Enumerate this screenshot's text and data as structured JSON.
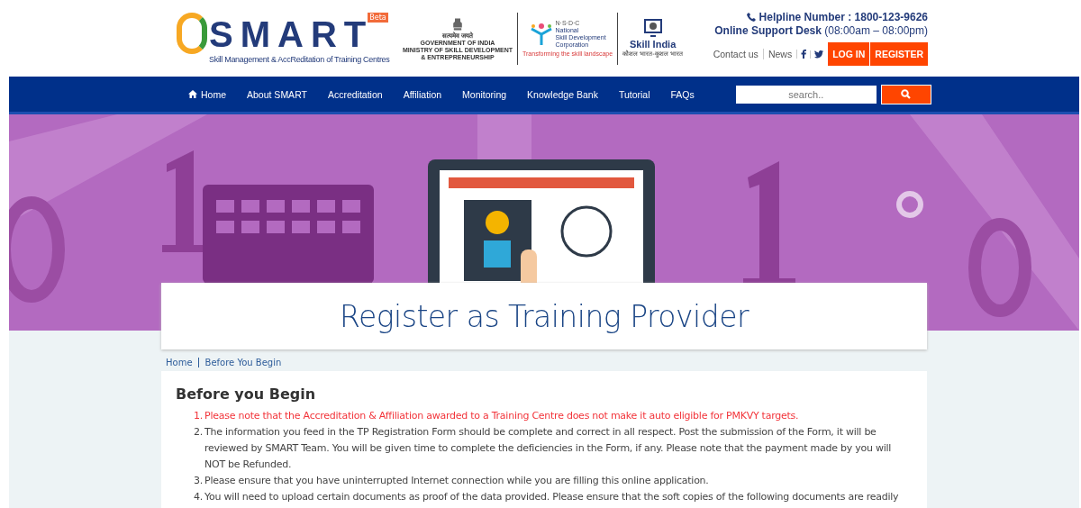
{
  "header": {
    "logo": {
      "title": "SMART",
      "badge": "Beta",
      "subtitle": "Skill Management & AccReditation of Training Centres"
    },
    "partners": [
      {
        "kind": "emblem",
        "lines": [
          "सत्यमेव जयते",
          "GOVERNMENT OF INDIA",
          "MINISTRY OF SKILL DEVELOPMENT",
          "& ENTREPRENEURSHIP"
        ]
      },
      {
        "kind": "nsdc",
        "lines": [
          "N·S·D·C",
          "National",
          "Skill Development",
          "Corporation",
          "Transforming the skill landscape"
        ]
      },
      {
        "kind": "skillindia",
        "lines": [
          "Skill India",
          "कौशल भारत-कुशल भारत"
        ]
      }
    ],
    "helpline": "Helpline Number : 1800-123-9626",
    "support": "Online Support Desk",
    "support_hours": "(08:00am – 08:00pm)",
    "links": [
      "Contact us",
      "News"
    ],
    "buttons": [
      "LOG IN",
      "REGISTER"
    ]
  },
  "nav": {
    "items": [
      "Home",
      "About SMART",
      "Accreditation",
      "Affiliation",
      "Monitoring",
      "Knowledge Bank",
      "Tutorial",
      "FAQs"
    ],
    "search": {
      "placeholder": "search.."
    }
  },
  "page_title": "Register as Training Provider",
  "breadcrumb": [
    "Home",
    "Before You Begin"
  ],
  "section": {
    "title": "Before you Begin",
    "items": [
      {
        "number": "1.",
        "text": "Please note that the Accreditation & Affiliation awarded to a Training Centre does not make it auto eligible for PMKVY targets.",
        "highlight": true
      },
      {
        "number": "2.",
        "text": "The information you feed in the TP Registration Form should be complete and correct in all respect. Post the submission of the Form, it will be reviewed by SMART Team. You will be given time to complete the deficiencies in the Form, if any. Please note that the payment made by you will NOT be Refunded.",
        "highlight": false
      },
      {
        "number": "3.",
        "text": "Please ensure that you have uninterrupted Internet connection while you are filling this online application.",
        "highlight": false
      },
      {
        "number": "4.",
        "text": "You will need to upload certain documents as proof of the data provided. Please ensure that the soft copies of the following documents are readily",
        "highlight": false
      }
    ]
  }
}
